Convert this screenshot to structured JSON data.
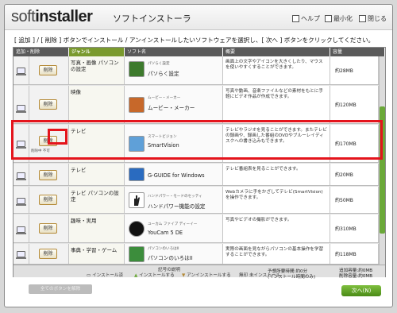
{
  "app": {
    "logo_a": "soft",
    "logo_b": "installer",
    "title": "ソフトインストーラ"
  },
  "titlebar_buttons": {
    "help": "ヘルプ",
    "minimize": "最小化",
    "close": "閉じる"
  },
  "instruction": "[ 追加 ] / [ 削除 ] ボタンでインストール / アンインストールしたいソフトウェアを選択し、[ 次へ ] ボタンをクリックしてください。",
  "columns": {
    "add_remove": "追加・削除",
    "genre": "ジャンル",
    "software": "ソフト名",
    "summary": "概要",
    "capacity": "容量"
  },
  "rows": [
    {
      "genre": "写真・画像 パソコンの設定",
      "del": "削除",
      "small": "パソらく設定",
      "name": "パソらく設定",
      "desc": "画面上の文字やアイコンを大きくしたり、マウスを使いやすくすることができます。",
      "size": "約28MB"
    },
    {
      "genre": "映像",
      "del": "削除",
      "small": "ムービー・メーカー",
      "name": "ムービー・メーカー",
      "desc": "写真や動画、音楽ファイルなどの素材をもとに手軽にビデオ作品が作成できます。",
      "size": "約120MB"
    },
    {
      "genre": "テレビ",
      "del": "削除",
      "sub": "削除中 不可",
      "small": "スマートビジョン",
      "name": "SmartVision",
      "desc": "テレビやラジオを見ることができます。またテレビの録画や、録画した番組のDVDやブルーレイディスクへの書き込みもできます。",
      "size": "約170MB"
    },
    {
      "genre": "テレビ",
      "del": "削除",
      "small": "",
      "name": "G-GUIDE for Windows",
      "desc": "テレビ番組表を見ることができます。",
      "size": "約20MB"
    },
    {
      "genre": "テレビ パソコンの設定",
      "del": "削除",
      "small": "ハンドパワー・モードのセッティ",
      "name": "ハンドパワー機能の設定",
      "desc": "Webカメラに手をかざしてテレビ(SmartVision)を操作できます。",
      "size": "約50MB"
    },
    {
      "genre": "趣味・実用",
      "del": "削除",
      "small": "ユーカム ファイブ ディーイー",
      "name": "YouCam 5 DE",
      "desc": "写真やビデオの撮影ができます。",
      "size": "約310MB"
    },
    {
      "genre": "事典・学習・ゲーム",
      "del": "削除",
      "small": "パソコンのいろはII",
      "name": "パソコンのいろはII",
      "desc": "実際の画面を見ながらパソコンの基本操作を学習することができます。",
      "size": "約118MB"
    }
  ],
  "footer": {
    "legend_title": "記号の説明",
    "installed": "インストール済",
    "install": "インストールする",
    "uninstall": "アンインストールする",
    "none": "無印 未インストール"
  },
  "all_button": "全てのボタンを解除",
  "totals": {
    "required_label": "予想所要時間:約0分",
    "time_note": "(インストール時間のみ)",
    "add": "追加容量:約0MB",
    "remove": "削除容量:約0MB"
  },
  "next_button": "次へ(N)",
  "colors": {
    "accent_green": "#6aa838",
    "highlight_red": "#e4141c"
  }
}
